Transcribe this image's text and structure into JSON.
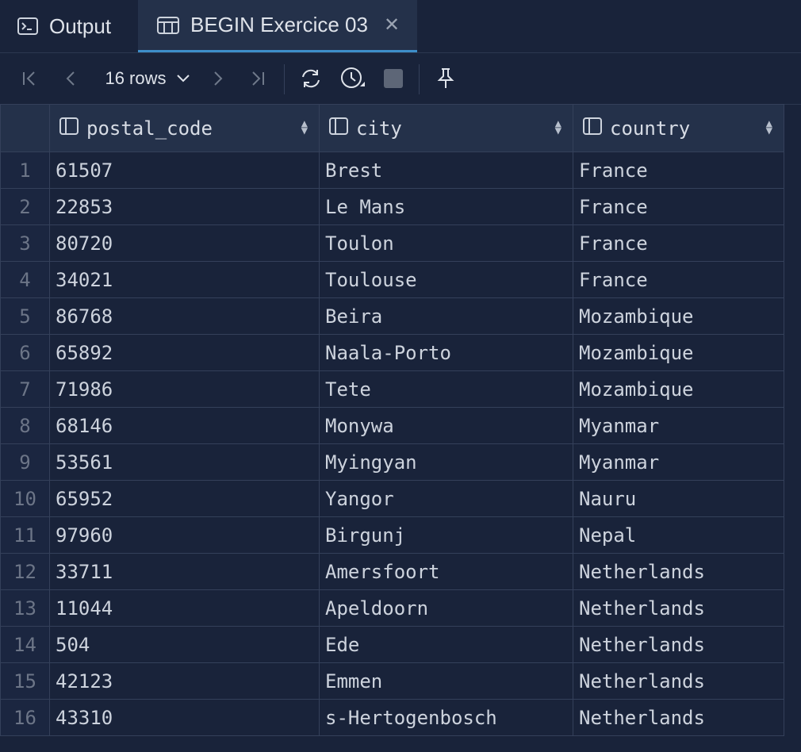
{
  "tabs": [
    {
      "label": "Output",
      "icon": "terminal-icon"
    },
    {
      "label": "BEGIN Exercice 03",
      "icon": "table-icon",
      "active": true
    }
  ],
  "toolbar": {
    "rows_label": "16 rows"
  },
  "columns": [
    "postal_code",
    "city",
    "country"
  ],
  "rows": [
    {
      "n": "1",
      "postal_code": "61507",
      "city": "Brest",
      "country": "France"
    },
    {
      "n": "2",
      "postal_code": "22853",
      "city": "Le Mans",
      "country": "France"
    },
    {
      "n": "3",
      "postal_code": "80720",
      "city": "Toulon",
      "country": "France"
    },
    {
      "n": "4",
      "postal_code": "34021",
      "city": "Toulouse",
      "country": "France"
    },
    {
      "n": "5",
      "postal_code": "86768",
      "city": "Beira",
      "country": "Mozambique"
    },
    {
      "n": "6",
      "postal_code": "65892",
      "city": "Naala-Porto",
      "country": "Mozambique"
    },
    {
      "n": "7",
      "postal_code": "71986",
      "city": "Tete",
      "country": "Mozambique"
    },
    {
      "n": "8",
      "postal_code": "68146",
      "city": "Monywa",
      "country": "Myanmar"
    },
    {
      "n": "9",
      "postal_code": "53561",
      "city": "Myingyan",
      "country": "Myanmar"
    },
    {
      "n": "10",
      "postal_code": "65952",
      "city": "Yangor",
      "country": "Nauru"
    },
    {
      "n": "11",
      "postal_code": "97960",
      "city": "Birgunj",
      "country": "Nepal"
    },
    {
      "n": "12",
      "postal_code": "33711",
      "city": "Amersfoort",
      "country": "Netherlands"
    },
    {
      "n": "13",
      "postal_code": "11044",
      "city": "Apeldoorn",
      "country": "Netherlands"
    },
    {
      "n": "14",
      "postal_code": "504",
      "city": "Ede",
      "country": "Netherlands"
    },
    {
      "n": "15",
      "postal_code": "42123",
      "city": "Emmen",
      "country": "Netherlands"
    },
    {
      "n": "16",
      "postal_code": "43310",
      "city": "s-Hertogenbosch",
      "country": "Netherlands"
    }
  ]
}
